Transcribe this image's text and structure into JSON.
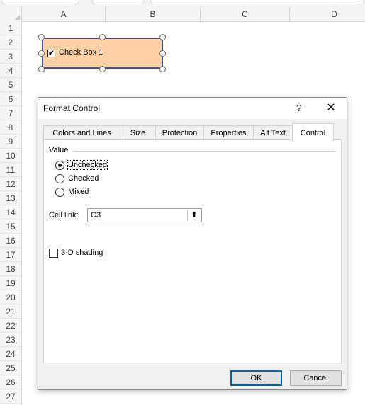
{
  "spreadsheet": {
    "columns": [
      "A",
      "B",
      "C",
      "D"
    ],
    "rows": [
      "1",
      "2",
      "3",
      "4",
      "5",
      "6",
      "7",
      "8",
      "9",
      "10",
      "11",
      "12",
      "13",
      "14",
      "15",
      "16",
      "17",
      "18",
      "19",
      "20",
      "21",
      "22",
      "23",
      "24",
      "25",
      "26",
      "27"
    ]
  },
  "checkbox_control": {
    "label": "Check Box 1",
    "checked": true,
    "check_glyph": "✔",
    "fill_color": "#fdd0a6",
    "border_color": "#4b4e8e"
  },
  "dialog": {
    "title": "Format Control",
    "help_glyph": "?",
    "close_glyph": "✕",
    "tabs": [
      "Colors and Lines",
      "Size",
      "Protection",
      "Properties",
      "Alt Text",
      "Control"
    ],
    "active_tab": "Control",
    "value_group": {
      "label": "Value",
      "options": [
        "Unchecked",
        "Checked",
        "Mixed"
      ],
      "selected": "Unchecked"
    },
    "cell_link": {
      "label": "Cell link:",
      "value": "C3",
      "button_glyph": "⬆"
    },
    "shading": {
      "label": "3-D shading",
      "checked": false
    },
    "ok_label": "OK",
    "cancel_label": "Cancel",
    "accent_color": "#0063b1"
  }
}
